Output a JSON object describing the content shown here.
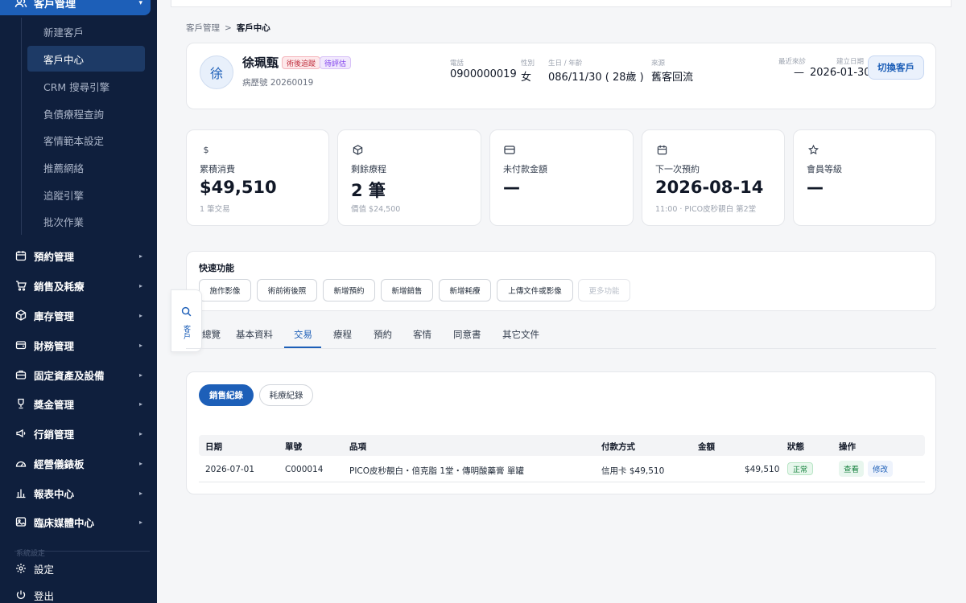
{
  "sidebar": {
    "section_title": "客戶管理",
    "sub_items": [
      "新建客戶",
      "客戶中心",
      "CRM 搜尋引擎",
      "負債療程查詢",
      "客情範本設定",
      "推薦網絡",
      "追蹤引擎",
      "批次作業"
    ],
    "active_sub": "客戶中心",
    "nav_items": [
      "預約管理",
      "銷售及耗療",
      "庫存管理",
      "財務管理",
      "固定資產及設備",
      "獎金管理",
      "行銷管理",
      "經營儀錶板",
      "報表中心",
      "臨床媒體中心"
    ],
    "faded_label": "系統設定",
    "settings_label": "設定",
    "logout_label": "登出"
  },
  "breadcrumb": {
    "parent": "客戶管理",
    "separator": ">",
    "current": "客戶中心"
  },
  "patient": {
    "avatar_char": "徐",
    "name": "徐珮甄",
    "tags": [
      "術後追蹤",
      "待評估"
    ],
    "mrn": "病歷號 20260019",
    "phone_label": "電話",
    "phone": "0900000019",
    "gender_label": "性別",
    "gender": "女",
    "birth_label": "生日 / 年齡",
    "birth": "086/11/30 ( 28歲 )",
    "source_label": "來源",
    "source": "舊客回流",
    "last_visit_label": "最近來診",
    "last_visit": "—",
    "created_label": "建立日期",
    "created": "2026-01-30",
    "switch_button": "切換客戶"
  },
  "stats": [
    {
      "icon": "dollar-icon",
      "label": "累積消費",
      "value": "$49,510",
      "sub": "1 筆交易"
    },
    {
      "icon": "box-icon",
      "label": "剩餘療程",
      "value": "2 筆",
      "sub": "價值 $24,500"
    },
    {
      "icon": "card-icon",
      "label": "未付款金額",
      "value": "—",
      "sub": ""
    },
    {
      "icon": "calendar-icon",
      "label": "下一次預約",
      "value": "2026-08-14",
      "sub": "11:00 · PICO皮秒靚白 第2堂"
    },
    {
      "icon": "star-icon",
      "label": "會員等級",
      "value": "—",
      "sub": ""
    }
  ],
  "quick": {
    "title": "快速功能",
    "buttons": [
      "施作影像",
      "術前術後照",
      "新增預約",
      "新增銷售",
      "新增耗療",
      "上傳文件或影像",
      "更多功能"
    ]
  },
  "float_search": {
    "label": "客戶"
  },
  "tabs": [
    "總覽",
    "基本資料",
    "交易",
    "療程",
    "預約",
    "客情",
    "同意書",
    "其它文件"
  ],
  "active_tab": "交易",
  "records": {
    "pill_active": "銷售紀錄",
    "pill_inactive": "耗療紀錄",
    "columns": [
      "日期",
      "單號",
      "品項",
      "付款方式",
      "金額",
      "狀態",
      "操作"
    ],
    "rows": [
      {
        "date": "2026-07-01",
        "no": "C000014",
        "item": "PICO皮秒靚白・倍克脂 1堂・傳明酸藥膏 單罐",
        "payment": "信用卡 $49,510",
        "amount": "$49,510",
        "status": "正常",
        "view": "查看",
        "edit": "修改"
      }
    ]
  },
  "colors": {
    "primary": "#1d5fb8",
    "sidebar_bg": "#0f1f3d",
    "success": "#15803d"
  }
}
